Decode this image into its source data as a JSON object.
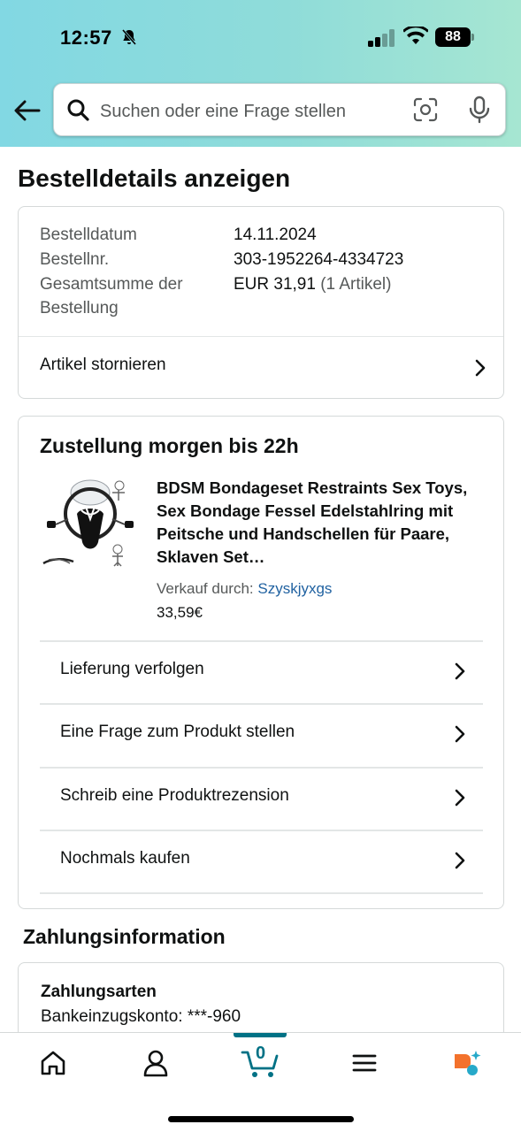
{
  "status_bar": {
    "time": "12:57",
    "battery": "88"
  },
  "search": {
    "placeholder": "Suchen oder eine Frage stellen"
  },
  "page": {
    "title": "Bestelldetails anzeigen"
  },
  "order_summary": {
    "date_label": "Bestelldatum",
    "date_value": "14.11.2024",
    "number_label": "Bestellnr.",
    "number_value": "303-1952264-4334723",
    "total_label_line1": "Gesamtsumme der",
    "total_label_line2": "Bestellung",
    "total_value": "EUR 31,91",
    "total_items": "(1 Artikel)",
    "cancel_label": "Artikel stornieren"
  },
  "shipment": {
    "heading": "Zustellung morgen bis 22h",
    "product_title": "BDSM Bondageset Restraints Sex Toys, Sex Bondage Fessel Edelstahlring mit Peitsche und Handschellen für Paare, Sklaven Set…",
    "seller_prefix": "Verkauf durch:",
    "seller_name": "Szyskjyxgs",
    "price": "33,59€",
    "actions": [
      {
        "label": "Lieferung verfolgen"
      },
      {
        "label": "Eine Frage zum Produkt stellen"
      },
      {
        "label": "Schreib eine Produktrezension"
      },
      {
        "label": "Nochmals kaufen"
      }
    ]
  },
  "payment": {
    "heading": "Zahlungsinformation",
    "method_heading": "Zahlungsarten",
    "method_value": "Bankeinzugskonto: ***-960"
  },
  "tab_bar": {
    "cart_count": "0",
    "icons": [
      "home-icon",
      "account-icon",
      "cart-icon",
      "menu-icon",
      "rufus-ai-icon"
    ],
    "accent_color": "#007185"
  }
}
